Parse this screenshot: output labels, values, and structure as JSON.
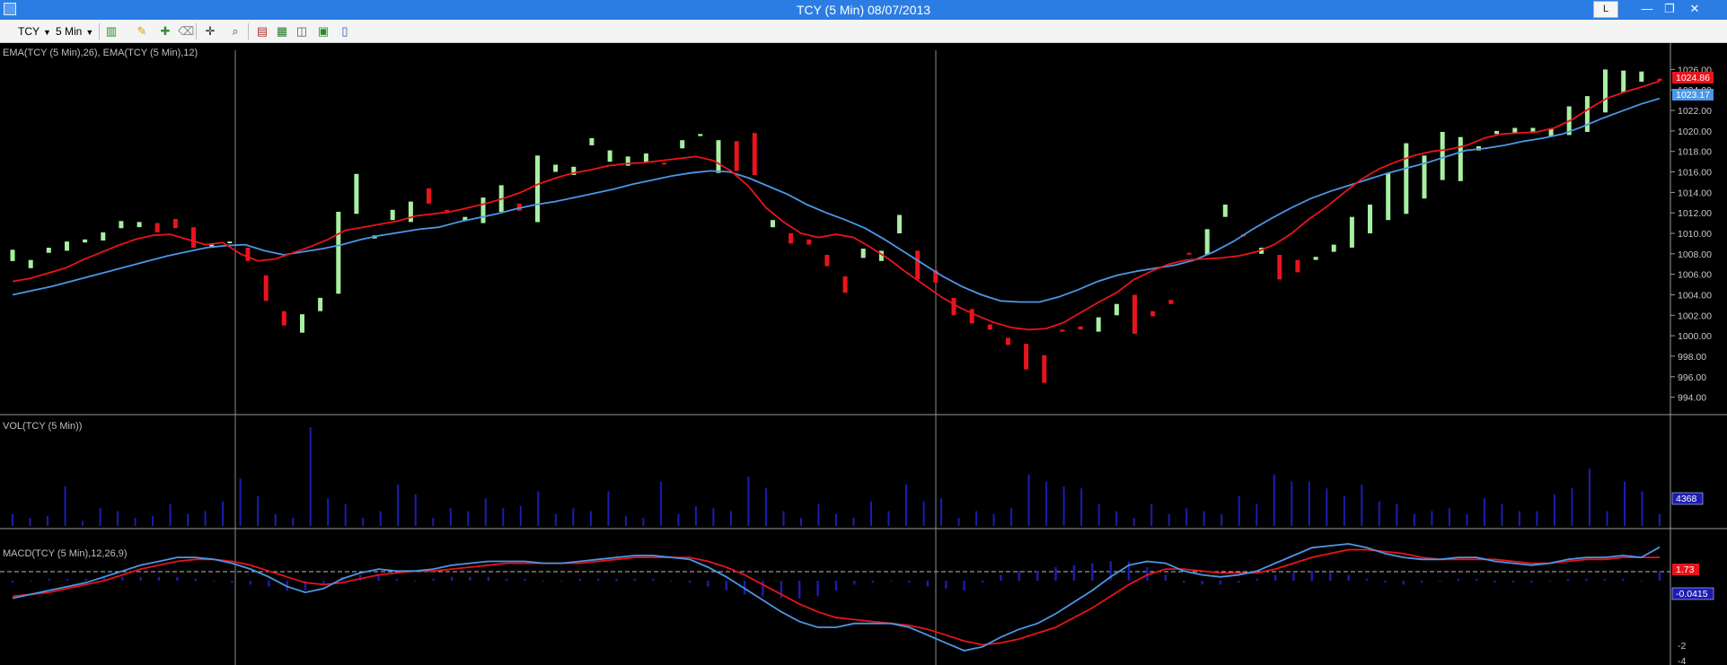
{
  "window": {
    "title": "TCY (5 Min)  08/07/2013",
    "button_l": "L",
    "min_glyph": "—",
    "max_glyph": "❐",
    "close_glyph": "✕"
  },
  "toolbar": {
    "symbol": "TCY",
    "interval": "5 Min",
    "icons": [
      "bar-style-icon",
      "draw-pencil-icon",
      "add-study-icon",
      "eraser-icon",
      "crosshair-icon",
      "zoom-icon",
      "insert-indicator-icon",
      "strategy-icon",
      "chart-window-icon",
      "export-icon",
      "layout-icon"
    ]
  },
  "panels": {
    "price": {
      "label": "EMA(TCY (5 Min),26), EMA(TCY (5 Min),12)",
      "ticks": [
        "1026.00",
        "1024.00",
        "1022.00",
        "1020.00",
        "1018.00",
        "1016.00",
        "1014.00",
        "1012.00",
        "1010.00",
        "1008.00",
        "1006.00",
        "1004.00",
        "1002.00",
        "1000.00",
        "998.00",
        "996.00",
        "994.00"
      ],
      "tag_red": "1024.86",
      "tag_blue": "1023.17",
      "ylim": [
        993,
        1027
      ]
    },
    "volume": {
      "label": "VOL(TCY (5 Min))",
      "tag": "4368"
    },
    "macd": {
      "label": "MACD(TCY (5 Min),12,26,9)",
      "tag_red": "1.73",
      "tag_blue": "-0.0415",
      "ticks": [
        "-2",
        "-4"
      ]
    }
  },
  "colors": {
    "up": "#a8efa1",
    "down": "#e8141c",
    "ema12": "#e8141c",
    "ema26": "#4b97e8",
    "volume": "#1c1cb4",
    "macd_line": "#4b97e8",
    "signal_line": "#e8141c"
  },
  "chart_data": {
    "type": "candlestick",
    "n_bars": 92,
    "price": {
      "open": [
        1007.3,
        1006.6,
        1008.1,
        1008.3,
        1009.1,
        1009.3,
        1010.5,
        1010.6,
        1011.0,
        1011.4,
        1010.6,
        1008.9,
        1009.2,
        1008.6,
        1005.9,
        1002.4,
        1000.3,
        1002.4,
        1004.1,
        1011.9,
        1009.5,
        1011.3,
        1011.1,
        1014.4,
        1012.3,
        1011.2,
        1011.0,
        1012.1,
        1012.9,
        1011.1,
        1016.0,
        1015.7,
        1018.6,
        1017.0,
        1016.6,
        1016.9,
        1016.9,
        1018.3,
        1019.5,
        1015.9,
        1019.0,
        1019.8,
        1010.6,
        1010.0,
        1009.4,
        1007.9,
        1005.8,
        1007.6,
        1007.3,
        1010.0,
        1008.3,
        1006.4,
        1003.7,
        1002.6,
        1001.1,
        999.8,
        999.2,
        998.1,
        1000.6,
        1000.9,
        1000.4,
        1002.0,
        1004.0,
        1002.4,
        1003.5,
        1008.1,
        1007.9,
        1011.6,
        1009.9,
        1008.0,
        1007.9,
        1007.4,
        1007.4,
        1008.2,
        1008.6,
        1010.0,
        1011.3,
        1011.9,
        1013.4,
        1015.2,
        1015.1,
        1018.1,
        1019.7,
        1019.8,
        1019.8,
        1019.5,
        1019.6,
        1019.9,
        1021.8,
        1023.8,
        1024.8,
        1025.1
      ],
      "close": [
        1008.4,
        1007.4,
        1008.6,
        1009.2,
        1009.4,
        1010.1,
        1011.2,
        1011.1,
        1010.1,
        1010.5,
        1008.6,
        1008.9,
        1009.2,
        1007.3,
        1003.4,
        1001.0,
        1002.1,
        1003.7,
        1012.1,
        1015.8,
        1009.8,
        1012.3,
        1013.1,
        1012.9,
        1012.1,
        1011.6,
        1013.5,
        1014.7,
        1012.2,
        1017.6,
        1016.7,
        1016.5,
        1019.3,
        1018.1,
        1017.5,
        1017.8,
        1016.8,
        1019.1,
        1019.7,
        1019.1,
        1016.1,
        1015.7,
        1011.3,
        1009.0,
        1008.9,
        1006.8,
        1004.2,
        1008.5,
        1008.3,
        1011.8,
        1005.5,
        1005.2,
        1002.0,
        1001.2,
        1000.6,
        999.1,
        996.7,
        995.4,
        1000.4,
        1000.6,
        1001.8,
        1003.1,
        1000.2,
        1001.9,
        1003.1,
        1008.0,
        1010.4,
        1012.8,
        1009.7,
        1008.6,
        1005.5,
        1006.2,
        1007.7,
        1008.9,
        1011.6,
        1012.8,
        1015.9,
        1018.8,
        1017.6,
        1019.9,
        1019.4,
        1018.5,
        1020.0,
        1020.3,
        1020.3,
        1020.2,
        1022.4,
        1023.4,
        1026.0,
        1025.9,
        1025.8,
        1024.9
      ],
      "ema12": [
        1005.3,
        1005.6,
        1006.1,
        1006.6,
        1007.4,
        1008.1,
        1008.8,
        1009.4,
        1009.8,
        1009.9,
        1009.4,
        1008.9,
        1009.1,
        1008.0,
        1007.3,
        1007.5,
        1008.1,
        1008.7,
        1009.4,
        1010.3,
        1010.6,
        1010.9,
        1011.2,
        1011.7,
        1011.9,
        1012.1,
        1012.5,
        1012.9,
        1013.4,
        1014.0,
        1014.8,
        1015.4,
        1015.9,
        1016.2,
        1016.6,
        1016.8,
        1016.9,
        1017.1,
        1017.3,
        1017.5,
        1017.1,
        1016.1,
        1014.6,
        1012.5,
        1011.1,
        1010.0,
        1009.6,
        1009.9,
        1009.6,
        1008.6,
        1007.5,
        1006.2,
        1005.0,
        1003.8,
        1002.8,
        1002.0,
        1001.3,
        1000.8,
        1000.6,
        1000.7,
        1001.3,
        1002.3,
        1003.3,
        1004.2,
        1005.5,
        1006.3,
        1007.0,
        1007.4,
        1007.5,
        1007.6,
        1007.8,
        1008.2,
        1008.9,
        1010.0,
        1011.4,
        1012.6,
        1014.0,
        1015.3,
        1016.3,
        1017.0,
        1017.6,
        1018.0,
        1018.2,
        1018.6,
        1019.3,
        1019.7,
        1019.8,
        1019.9,
        1020.3,
        1021.1,
        1022.2,
        1023.2,
        1023.8,
        1024.3,
        1024.86
      ],
      "ema26": [
        1004.0,
        1004.4,
        1004.8,
        1005.3,
        1005.8,
        1006.3,
        1006.8,
        1007.3,
        1007.8,
        1008.2,
        1008.6,
        1008.8,
        1008.9,
        1008.3,
        1007.9,
        1008.2,
        1008.5,
        1008.9,
        1009.4,
        1009.8,
        1010.1,
        1010.4,
        1010.6,
        1011.1,
        1011.5,
        1011.9,
        1012.4,
        1012.8,
        1013.1,
        1013.5,
        1013.9,
        1014.3,
        1014.8,
        1015.2,
        1015.6,
        1015.9,
        1016.1,
        1016.0,
        1015.4,
        1014.6,
        1013.8,
        1012.8,
        1012.0,
        1011.3,
        1010.5,
        1009.4,
        1008.2,
        1007.0,
        1005.8,
        1004.8,
        1004.0,
        1003.4,
        1003.3,
        1003.3,
        1003.8,
        1004.5,
        1005.3,
        1005.9,
        1006.3,
        1006.6,
        1006.9,
        1007.4,
        1008.2,
        1009.2,
        1010.4,
        1011.5,
        1012.5,
        1013.4,
        1014.1,
        1014.7,
        1015.3,
        1015.9,
        1016.4,
        1016.9,
        1017.5,
        1018.1,
        1018.3,
        1018.6,
        1019.0,
        1019.3,
        1019.7,
        1020.4,
        1021.2,
        1021.9,
        1022.6,
        1023.17
      ]
    },
    "volume": [
      12,
      8,
      10,
      40,
      5,
      18,
      15,
      8,
      10,
      22,
      12,
      15,
      25,
      48,
      30,
      12,
      8,
      100,
      28,
      22,
      8,
      15,
      42,
      32,
      8,
      18,
      15,
      28,
      18,
      20,
      35,
      12,
      18,
      15,
      35,
      10,
      8,
      45,
      12,
      20,
      18,
      15,
      50,
      38,
      15,
      8,
      22,
      12,
      8,
      25,
      15,
      42,
      25,
      28,
      8,
      15,
      12,
      18,
      52,
      45,
      40,
      38,
      22,
      15,
      8,
      22,
      12,
      18,
      15,
      12,
      30,
      22,
      52,
      45,
      45,
      38,
      30,
      42,
      25,
      22,
      12,
      15,
      18,
      12,
      28,
      22,
      15,
      15,
      32,
      38,
      58,
      15,
      45,
      35,
      12
    ],
    "macd": {
      "macd_line": [
        -0.9,
        -0.7,
        -0.5,
        -0.3,
        -0.1,
        0.2,
        0.5,
        0.8,
        1.0,
        1.2,
        1.2,
        1.1,
        0.9,
        0.6,
        0.2,
        -0.3,
        -0.6,
        -0.4,
        0.1,
        0.4,
        0.6,
        0.5,
        0.5,
        0.6,
        0.8,
        0.9,
        1.0,
        1.0,
        1.0,
        0.9,
        0.9,
        1.0,
        1.1,
        1.2,
        1.3,
        1.3,
        1.2,
        1.1,
        0.7,
        0.2,
        -0.4,
        -1.0,
        -1.6,
        -2.1,
        -2.4,
        -2.4,
        -2.2,
        -2.2,
        -2.2,
        -2.4,
        -2.8,
        -3.2,
        -3.6,
        -3.4,
        -2.9,
        -2.5,
        -2.2,
        -1.7,
        -1.1,
        -0.5,
        0.2,
        0.8,
        1.0,
        0.9,
        0.5,
        0.3,
        0.2,
        0.3,
        0.5,
        0.9,
        1.3,
        1.7,
        1.8,
        1.9,
        1.7,
        1.4,
        1.2,
        1.1,
        1.1,
        1.2,
        1.2,
        1.0,
        0.9,
        0.8,
        0.9,
        1.1,
        1.2,
        1.2,
        1.3,
        1.2,
        1.73
      ],
      "signal_line": [
        -0.8,
        -0.7,
        -0.6,
        -0.4,
        -0.2,
        0.0,
        0.3,
        0.6,
        0.8,
        1.0,
        1.1,
        1.1,
        1.0,
        0.8,
        0.5,
        0.2,
        -0.1,
        -0.2,
        -0.1,
        0.1,
        0.3,
        0.4,
        0.5,
        0.5,
        0.6,
        0.7,
        0.8,
        0.9,
        0.9,
        0.9,
        0.9,
        0.9,
        1.0,
        1.1,
        1.2,
        1.2,
        1.2,
        1.2,
        1.0,
        0.7,
        0.3,
        -0.2,
        -0.7,
        -1.2,
        -1.6,
        -1.9,
        -2.0,
        -2.1,
        -2.2,
        -2.3,
        -2.5,
        -2.8,
        -3.1,
        -3.3,
        -3.2,
        -3.0,
        -2.7,
        -2.4,
        -1.9,
        -1.4,
        -0.8,
        -0.2,
        0.3,
        0.6,
        0.6,
        0.5,
        0.4,
        0.4,
        0.4,
        0.6,
        0.9,
        1.2,
        1.4,
        1.6,
        1.6,
        1.5,
        1.4,
        1.2,
        1.1,
        1.1,
        1.1,
        1.1,
        1.0,
        0.9,
        0.9,
        1.0,
        1.1,
        1.1,
        1.2,
        1.2,
        1.2
      ],
      "histogram": [
        -0.1,
        0.0,
        0.1,
        0.1,
        0.1,
        0.2,
        0.2,
        0.2,
        0.2,
        0.2,
        0.1,
        0.0,
        -0.1,
        -0.2,
        -0.3,
        -0.5,
        -0.5,
        -0.2,
        0.2,
        0.3,
        0.3,
        0.1,
        0.0,
        0.1,
        0.2,
        0.2,
        0.2,
        0.1,
        0.1,
        0.0,
        0.0,
        0.1,
        0.1,
        0.1,
        0.1,
        0.1,
        0.0,
        -0.1,
        -0.3,
        -0.5,
        -0.7,
        -0.8,
        -0.9,
        -0.9,
        -0.8,
        -0.5,
        -0.2,
        -0.1,
        0.0,
        -0.1,
        -0.3,
        -0.4,
        -0.5,
        -0.1,
        0.3,
        0.5,
        0.5,
        0.7,
        0.8,
        0.9,
        1.0,
        1.0,
        0.7,
        0.3,
        -0.1,
        -0.2,
        -0.2,
        -0.1,
        0.1,
        0.3,
        0.4,
        0.5,
        0.4,
        0.3,
        0.1,
        -0.1,
        -0.2,
        -0.1,
        0.0,
        0.1,
        0.1,
        -0.1,
        -0.1,
        -0.1,
        0.0,
        0.1,
        0.1,
        0.1,
        0.1,
        0.0,
        0.5
      ],
      "ylim": [
        -4.2,
        2.5
      ]
    }
  }
}
